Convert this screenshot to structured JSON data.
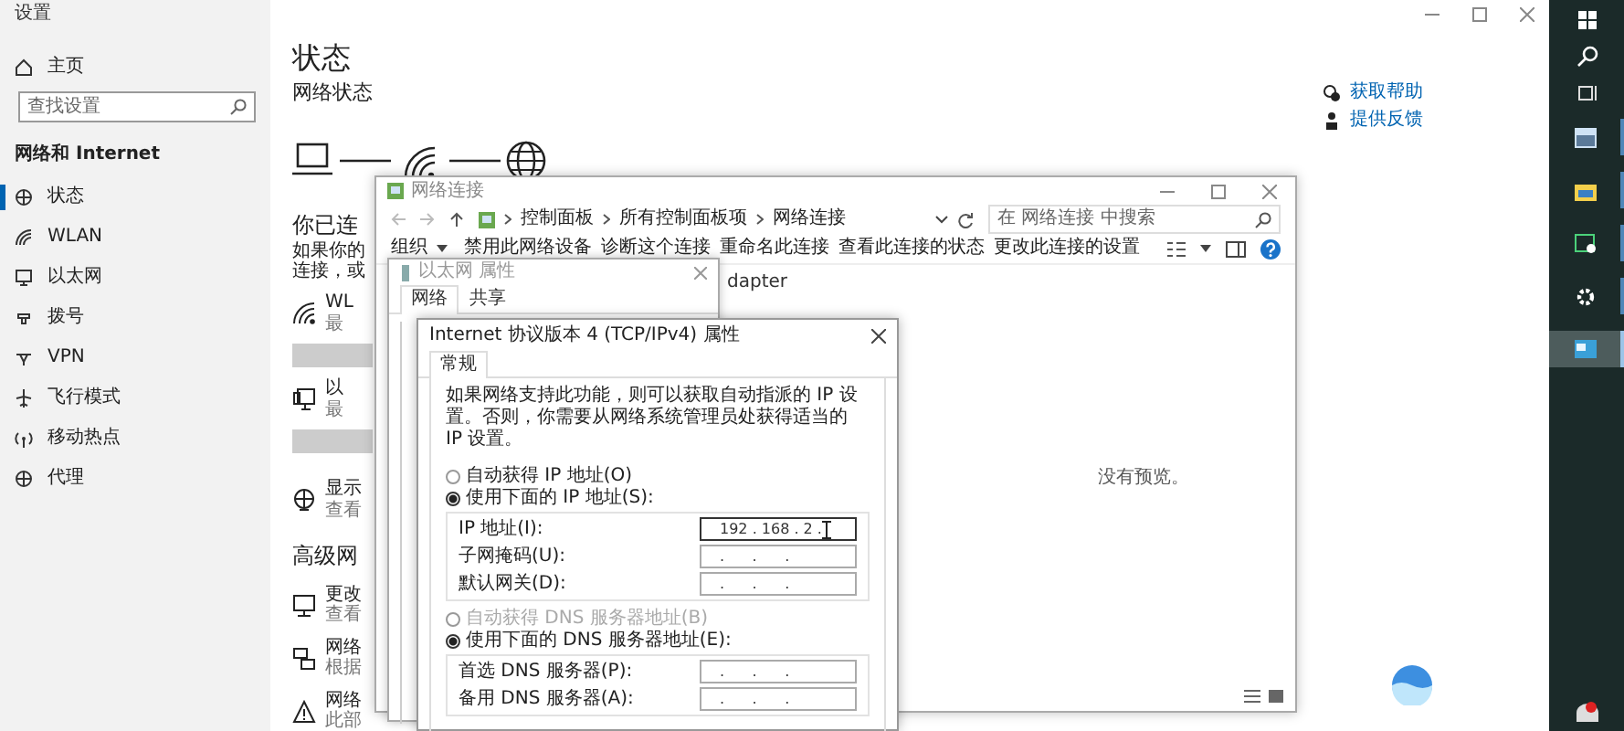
{
  "settings": {
    "title": "设置",
    "nav": {
      "home": "主页",
      "search": {
        "placeholder": "查找设置"
      },
      "section": "网络和 Internet",
      "items": [
        {
          "label": "状态",
          "selected": true
        },
        {
          "label": "WLAN",
          "selected": false
        },
        {
          "label": "以太网",
          "selected": false
        },
        {
          "label": "拨号",
          "selected": false
        },
        {
          "label": "VPN",
          "selected": false
        },
        {
          "label": "飞行模式",
          "selected": false
        },
        {
          "label": "移动热点",
          "selected": false
        },
        {
          "label": "代理",
          "selected": false
        }
      ]
    },
    "content": {
      "title": "状态",
      "subtitle": "网络状态",
      "connected_heading": "你已连",
      "connected_text": [
        "如果你的",
        "连接，或"
      ],
      "connections": [
        {
          "name": "WL",
          "detail": "最"
        },
        {
          "name": "以",
          "detail": "最"
        }
      ],
      "display": {
        "name": "显示",
        "detail": "查看"
      },
      "advanced_heading": "高级网",
      "advanced": [
        {
          "name": "更改",
          "detail": "查看"
        },
        {
          "name": "网络",
          "detail": "根据"
        },
        {
          "name": "网络",
          "detail": "此部"
        }
      ],
      "help": [
        "获取帮助",
        "提供反馈"
      ]
    }
  },
  "taskbar": {
    "apps": [
      {
        "selected": false
      },
      {
        "selected": false
      },
      {
        "selected": false
      },
      {
        "selected": false
      },
      {
        "selected": true
      }
    ]
  },
  "network_window": {
    "title": "网络连接",
    "breadcrumb": [
      "控制面板",
      "所有控制面板项",
      "网络连接"
    ],
    "search": {
      "placeholder": "在 网络连接 中搜索"
    },
    "toolbar": [
      "组织",
      "禁用此网络设备",
      "诊断这个连接",
      "重命名此连接",
      "查看此连接的状态",
      "更改此连接的设置"
    ],
    "adapter_fragment": "dapter",
    "preview": "没有预览。"
  },
  "ethernet_dialog": {
    "title": "以太网 属性",
    "tabs": [
      {
        "label": "网络",
        "selected": true
      },
      {
        "label": "共享",
        "selected": false
      }
    ]
  },
  "ipv4_dialog": {
    "title": "Internet 协议版本 4 (TCP/IPv4) 属性",
    "tabs": [
      {
        "label": "常规",
        "selected": true
      }
    ],
    "description": "如果网络支持此功能，则可以获取自动指派的 IP 设置。否则，你需要从网络系统管理员处获得适当的 IP 设置。",
    "ip_mode": [
      {
        "label": "自动获得 IP 地址(O)",
        "selected": false
      },
      {
        "label": "使用下面的 IP 地址(S):",
        "selected": true
      }
    ],
    "ip_fields": [
      {
        "label": "IP 地址(I):",
        "value": "192 . 168 . 2 .",
        "focused": true
      },
      {
        "label": "子网掩码(U):",
        "value": ".      .      .",
        "focused": false
      },
      {
        "label": "默认网关(D):",
        "value": ".      .      .",
        "focused": false
      }
    ],
    "dns_mode": [
      {
        "label": "自动获得 DNS 服务器地址(B)",
        "selected": false,
        "disabled": true
      },
      {
        "label": "使用下面的 DNS 服务器地址(E):",
        "selected": true,
        "disabled": false
      }
    ],
    "dns_fields": [
      {
        "label": "首选 DNS 服务器(P):",
        "value": ".      .      .",
        "focused": false
      },
      {
        "label": "备用 DNS 服务器(A):",
        "value": ".      .      .",
        "focused": false
      }
    ]
  }
}
